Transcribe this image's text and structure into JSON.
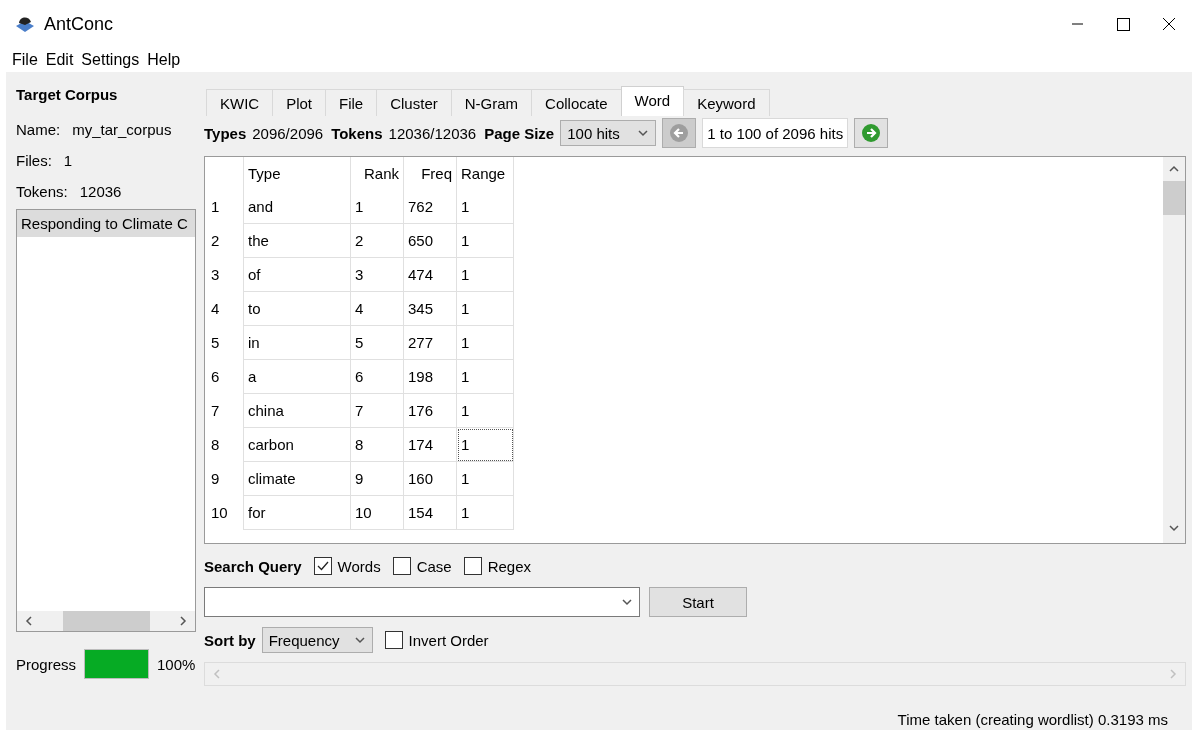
{
  "window": {
    "title": "AntConc"
  },
  "menu": [
    "File",
    "Edit",
    "Settings",
    "Help"
  ],
  "corpus": {
    "heading": "Target Corpus",
    "fields": [
      {
        "label": "Name:",
        "value": "my_tar_corpus"
      },
      {
        "label": "Files:",
        "value": "1"
      },
      {
        "label": "Tokens:",
        "value": "12036"
      }
    ],
    "files": [
      {
        "name": "Responding to Climate C",
        "selected": true
      }
    ],
    "progress": {
      "label": "Progress",
      "level": 1,
      "reading": "100%"
    }
  },
  "tabs": [
    {
      "label": "KWIC",
      "selected": false
    },
    {
      "label": "Plot",
      "selected": false
    },
    {
      "label": "File",
      "selected": false
    },
    {
      "label": "Cluster",
      "selected": false
    },
    {
      "label": "N-Gram",
      "selected": false
    },
    {
      "label": "Collocate",
      "selected": false
    },
    {
      "label": "Word",
      "selected": true
    },
    {
      "label": "Keyword",
      "selected": false
    }
  ],
  "stats": [
    {
      "label": "Types",
      "value": "2096/2096"
    },
    {
      "label": "Tokens",
      "value": "12036/12036"
    }
  ],
  "page_size": {
    "label": "Page Size",
    "value": "100 hits"
  },
  "pager": {
    "prev_disabled": true,
    "range": "1 to 100 of 2096 hits",
    "next_disabled": false
  },
  "table": {
    "columns": [
      "Type",
      "Rank",
      "Freq",
      "Range"
    ],
    "rows": [
      {
        "index": "1",
        "cells": [
          "and",
          "1",
          "762",
          "1"
        ],
        "focused": false
      },
      {
        "index": "2",
        "cells": [
          "the",
          "2",
          "650",
          "1"
        ],
        "focused": false
      },
      {
        "index": "3",
        "cells": [
          "of",
          "3",
          "474",
          "1"
        ],
        "focused": false
      },
      {
        "index": "4",
        "cells": [
          "to",
          "4",
          "345",
          "1"
        ],
        "focused": false
      },
      {
        "index": "5",
        "cells": [
          "in",
          "5",
          "277",
          "1"
        ],
        "focused": false
      },
      {
        "index": "6",
        "cells": [
          "a",
          "6",
          "198",
          "1"
        ],
        "focused": false
      },
      {
        "index": "7",
        "cells": [
          "china",
          "7",
          "176",
          "1"
        ],
        "focused": false
      },
      {
        "index": "8",
        "cells": [
          "carbon",
          "8",
          "174",
          "1"
        ],
        "focused": true
      },
      {
        "index": "9",
        "cells": [
          "climate",
          "9",
          "160",
          "1"
        ],
        "focused": false
      },
      {
        "index": "10",
        "cells": [
          "for",
          "10",
          "154",
          "1"
        ],
        "focused": false
      }
    ]
  },
  "search": {
    "label": "Search Query",
    "options": [
      {
        "label": "Words",
        "checked": true
      },
      {
        "label": "Case",
        "checked": false
      },
      {
        "label": "Regex",
        "checked": false
      }
    ],
    "button": "Start"
  },
  "sort": {
    "label": "Sort by",
    "value": "Frequency",
    "invert": {
      "label": "Invert Order",
      "checked": false
    }
  },
  "status": "Time taken (creating wordlist) 0.3193 ms"
}
